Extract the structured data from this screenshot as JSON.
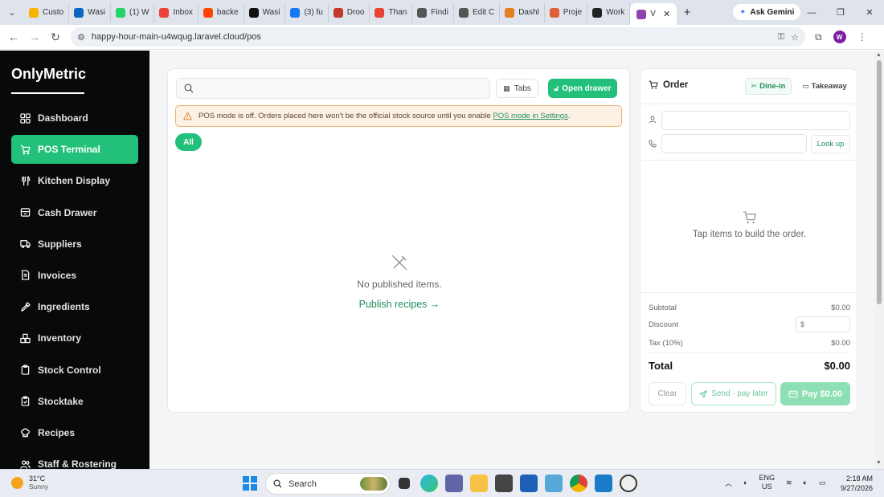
{
  "browser": {
    "tabs": [
      {
        "title": "Custo",
        "color": "#f4b400"
      },
      {
        "title": "Wasi",
        "color": "#0a66c2"
      },
      {
        "title": "(1) W",
        "color": "#25d366"
      },
      {
        "title": "Inbox",
        "color": "#ea4335"
      },
      {
        "title": "backe",
        "color": "#ff4500"
      },
      {
        "title": "Wasi",
        "color": "#111111"
      },
      {
        "title": "(3) fu",
        "color": "#1877f2"
      },
      {
        "title": "Droo",
        "color": "#c0392b"
      },
      {
        "title": "Than",
        "color": "#ea4335"
      },
      {
        "title": "Findi",
        "color": "#555555"
      },
      {
        "title": "Edit C",
        "color": "#555555"
      },
      {
        "title": "Dashl",
        "color": "#e67e22"
      },
      {
        "title": "Proje",
        "color": "#e0603a"
      },
      {
        "title": "Work",
        "color": "#222222"
      }
    ],
    "active_tab": {
      "title": "V",
      "color": "#8e44ad"
    },
    "ask_gemini": "Ask Gemini",
    "url": "happy-hour-main-u4wqug.laravel.cloud/pos",
    "profile_initial": "W"
  },
  "sidebar": {
    "brand": "OnlyMetric",
    "items": [
      {
        "label": "Dashboard",
        "icon": "dashboard-icon"
      },
      {
        "label": "POS Terminal",
        "icon": "cart-icon"
      },
      {
        "label": "Kitchen Display",
        "icon": "utensils-icon"
      },
      {
        "label": "Cash Drawer",
        "icon": "drawer-icon"
      },
      {
        "label": "Suppliers",
        "icon": "truck-icon"
      },
      {
        "label": "Invoices",
        "icon": "invoice-icon"
      },
      {
        "label": "Ingredients",
        "icon": "pipette-icon"
      },
      {
        "label": "Inventory",
        "icon": "boxes-icon"
      },
      {
        "label": "Stock Control",
        "icon": "clipboard-icon"
      },
      {
        "label": "Stocktake",
        "icon": "clipboard-check-icon"
      },
      {
        "label": "Recipes",
        "icon": "chef-hat-icon"
      },
      {
        "label": "Staff & Rostering",
        "icon": "users-icon"
      }
    ],
    "active_index": 1
  },
  "pos": {
    "search_placeholder": "",
    "tabs_button": "Tabs",
    "open_drawer_button": "Open drawer",
    "alert_text": "POS mode is off. Orders placed here won't be the official stock source until you enable ",
    "alert_link": "POS mode in Settings",
    "alert_end": ".",
    "category_all": "All",
    "empty_message": "No published items.",
    "publish_link": "Publish recipes →"
  },
  "order": {
    "title": "Order",
    "dine_in": "Dine-in",
    "takeaway": "Takeaway",
    "name_value": "",
    "phone_value": "",
    "lookup": "Look up",
    "empty_cart": "Tap items to build the order.",
    "subtotal_label": "Subtotal",
    "subtotal_value": "$0.00",
    "discount_label": "Discount",
    "discount_prefix": "$",
    "tax_label": "Tax (10%)",
    "tax_value": "$0.00",
    "total_label": "Total",
    "total_value": "$0.00",
    "clear": "Clear",
    "send": "Send · pay later",
    "pay": "Pay $0.00"
  },
  "colors": {
    "accent": "#22c07a",
    "sidebar_bg": "#07090b",
    "alert_border": "#eeb071",
    "link_green": "#1e8f5a"
  },
  "taskbar": {
    "temperature": "31°C",
    "condition": "Sunny",
    "search": "Search",
    "lang_1": "ENG",
    "lang_2": "US",
    "time": "2:18 AM",
    "date": "9/27/2026"
  }
}
